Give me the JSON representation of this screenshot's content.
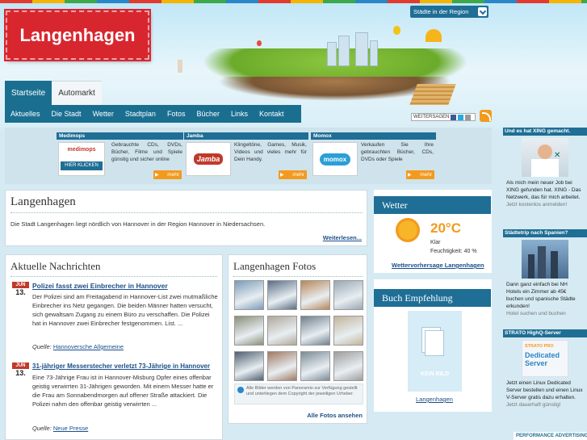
{
  "header": {
    "logo": "Langenhagen",
    "region_select": "Städte in der Region",
    "tabs": [
      {
        "label": "Startseite",
        "active": true
      },
      {
        "label": "Automarkt",
        "active": false
      }
    ],
    "nav": [
      "Aktuelles",
      "Die Stadt",
      "Wetter",
      "Stadtplan",
      "Fotos",
      "Bücher",
      "Links",
      "Kontakt"
    ],
    "share_label": "WEITERSAGEN"
  },
  "ads": [
    {
      "title": "Medimops",
      "logo": "medimops",
      "logo_button": "HIER KLICKEN",
      "text": "Gebrauchte CDs, DVDs, Bücher, Filme und Spiele günstig und sicher online",
      "more": "mehr"
    },
    {
      "title": "Jamba",
      "logo": "Jamba",
      "text": "Klingeltöne, Games, Musik, Videos und vieles mehr für Dein Handy.",
      "more": "mehr"
    },
    {
      "title": "Momox",
      "logo": "momox",
      "text": "Verkaufen Sie Ihre gebrauchten Bücher, CDs, DVDs oder Spiele",
      "more": "mehr"
    }
  ],
  "intro": {
    "title": "Langenhagen",
    "text": "Die Stadt Langenhagen liegt nördlich von Hannover in der Region Hannover in Niedersachsen.",
    "more": "Weiterlesen..."
  },
  "news": {
    "title": "Aktuelle Nachrichten",
    "source_label": "Quelle:",
    "items": [
      {
        "month": "JUN",
        "day": "13.",
        "headline": "Polizei fasst zwei Einbrecher in Hannover",
        "body": "Der Polizei sind am Freitagabend in Hannover-List zwei mutmaßliche Einbrecher ins Netz gegangen. Die beiden Männer hatten versucht, sich gewaltsam Zugang zu einem Büro zu verschaffen. Die Polizei hat in Hannover zwei Einbrecher festgenommen. List. ...",
        "source": "Hannoversche Allgemeine"
      },
      {
        "month": "JUN",
        "day": "13.",
        "headline": "31-jähriger Messerstecher verletzt 73-Jährige in Hannover",
        "body": "Eine 73-Jährige Frau ist in Hannover-Misburg Opfer eines offenbar geistig verwirrten 31-Jährigen geworden. Mit einem Messer hatte er die Frau am Sonnabendmorgen auf offener Straße attackiert. Die Polizei nahm den offenbar geistig verwirrten ...",
        "source": "Neue Presse"
      }
    ]
  },
  "photos": {
    "title": "Langenhagen Fotos",
    "notice": "Alle Bilder werden von Panoramio zur Verfügung gestellt und unterliegen dem Copyright der jeweiligen Urheber.",
    "all_link": "Alle Fotos ansehen",
    "thumb_colors": [
      "#7a9cb8",
      "#5a6e85",
      "#b8865a",
      "#9aa7b2",
      "#8a8f7a",
      "#b0a89a",
      "#6f7f8c",
      "#c2b59a",
      "#4e5f70",
      "#a07a62",
      "#7b8b96",
      "#9e9e9e"
    ]
  },
  "weather": {
    "title": "Wetter",
    "temp": "20°C",
    "condition": "Klar",
    "humidity": "Feuchtigkeit: 40 %",
    "link": "Wettervorhersage Langenhagen"
  },
  "book": {
    "title": "Buch Empfehlung",
    "placeholder": "KEIN BILD",
    "link": "Langenhagen"
  },
  "sidebar_ads": [
    {
      "title": "Und es hat XING gemacht.",
      "text": "Als mich mein neuer Job bei XING gefunden hat. XING - Das Netzwerk, das für mich arbeitet.",
      "sub": "Jetzt kostenlos anmelden!"
    },
    {
      "title": "Städtetrip nach Spanien?",
      "text": "Dann ganz einfach bei NH Hotels ein Zimmer ab 45€ buchen und spanische Städte erkunden!",
      "sub": "Hotel suchen und buchen"
    },
    {
      "title": "STRATO HighQ-Server",
      "logo_line1": "STRATO PRO",
      "logo_line2": "Dedicated Server",
      "text": "Jetzt einen Linux Dedicated Server bestellen und einen Linux V-Server gratis dazu erhalten.",
      "sub": "Jetzt dauerhaft günstig!"
    }
  ],
  "footer_badge": "PERFORMANCE ADVERTISING",
  "colors": {
    "brand_red": "#d8262f",
    "nav_blue": "#1a6f91",
    "accent_orange": "#f39a1d",
    "link_blue": "#1a4f8a"
  }
}
